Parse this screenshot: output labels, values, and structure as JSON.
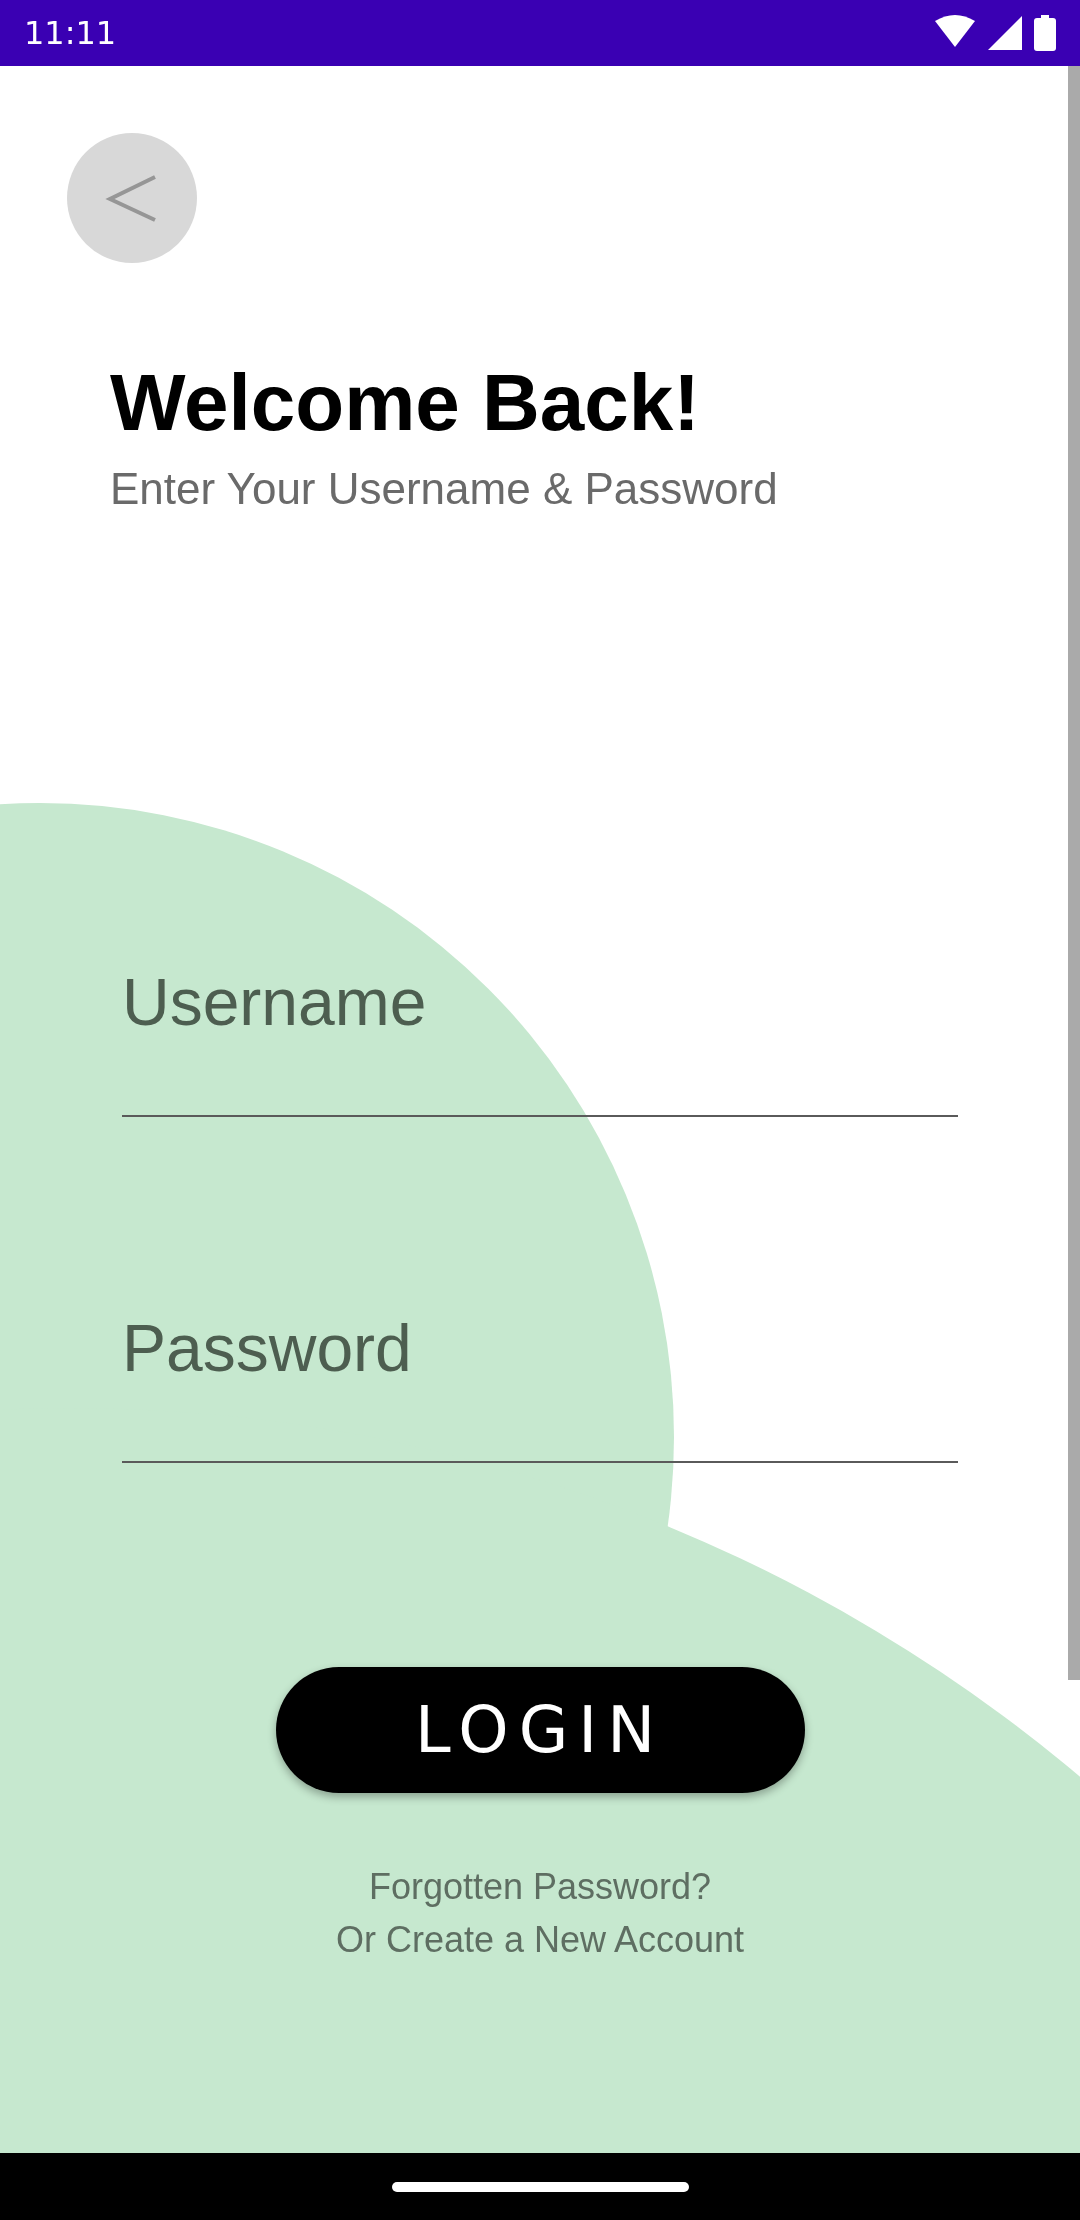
{
  "status_bar": {
    "time": "11:11"
  },
  "header": {
    "title": "Welcome Back!",
    "subtitle": "Enter Your Username & Password"
  },
  "fields": [
    {
      "placeholder": "Username"
    },
    {
      "placeholder": "Password"
    }
  ],
  "login_button": {
    "label": "LOGIN"
  },
  "links": [
    "Forgotten Password?",
    "Or Create a New Account"
  ]
}
